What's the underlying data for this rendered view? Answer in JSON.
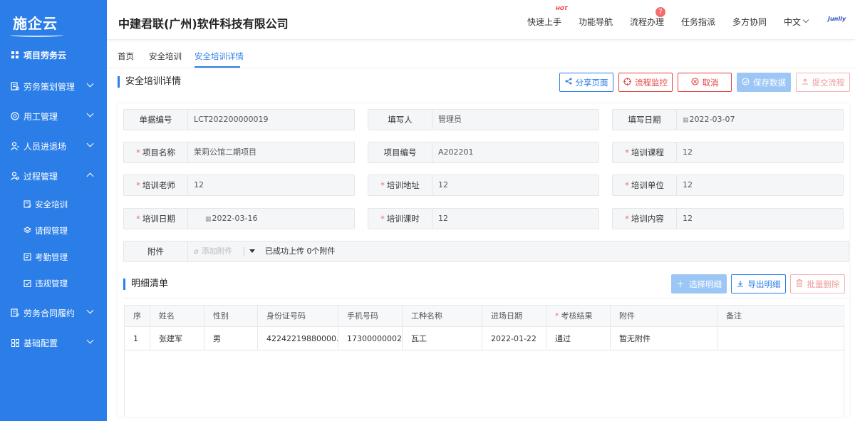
{
  "app": {
    "logo": "施企云"
  },
  "sidebar": {
    "home": "项目劳务云",
    "items": [
      {
        "label": "劳务策划管理",
        "icon": "plan-icon"
      },
      {
        "label": "用工管理",
        "icon": "employ-icon"
      },
      {
        "label": "人员进退场",
        "icon": "person-icon"
      },
      {
        "label": "过程管理",
        "icon": "process-icon"
      }
    ],
    "sub_items": [
      {
        "label": "安全培训",
        "icon": "training-icon"
      },
      {
        "label": "请假管理",
        "icon": "leave-icon"
      },
      {
        "label": "考勤管理",
        "icon": "attendance-icon"
      },
      {
        "label": "违规管理",
        "icon": "violation-icon"
      }
    ],
    "items_after": [
      {
        "label": "劳务合同履约",
        "icon": "contract-icon"
      },
      {
        "label": "基础配置",
        "icon": "config-icon"
      }
    ]
  },
  "header": {
    "company": "中建君联(广州)软件科技有限公司",
    "nav": [
      "快速上手",
      "功能导航",
      "流程办理",
      "任务指派",
      "多方协同",
      "中文"
    ],
    "hot_label": "HOT",
    "process_badge": "7",
    "brand": "Junlly"
  },
  "tabs": [
    "首页",
    "安全培训",
    "安全培训详情"
  ],
  "page": {
    "title": "安全培训详情",
    "actions": {
      "share": "分享页面",
      "monitor": "流程监控",
      "cancel": "取消",
      "save": "保存数据",
      "submit": "提交流程"
    }
  },
  "form": {
    "doc_no": {
      "label": "单据编号",
      "value": "LCT202200000019"
    },
    "writer": {
      "label": "填写人",
      "value": "管理员"
    },
    "write_date": {
      "label": "填写日期",
      "value": "2022-03-07"
    },
    "project_name": {
      "label": "项目名称",
      "value": "茉莉公馆二期项目"
    },
    "project_no": {
      "label": "项目编号",
      "value": "A202201"
    },
    "course": {
      "label": "培训课程",
      "value": "12"
    },
    "teacher": {
      "label": "培训老师",
      "value": "12"
    },
    "address": {
      "label": "培训地址",
      "value": "12"
    },
    "unit": {
      "label": "培训单位",
      "value": "12"
    },
    "train_date": {
      "label": "培训日期",
      "value": "2022-03-16"
    },
    "hours": {
      "label": "培训课时",
      "value": "12"
    },
    "content": {
      "label": "培训内容",
      "value": "12"
    },
    "attachment": {
      "label": "附件",
      "add": "添加附件",
      "status": "已成功上传 0个附件"
    }
  },
  "detail": {
    "title": "明细清单",
    "actions": {
      "select": "选择明细",
      "export": "导出明细",
      "delete": "批量删除"
    },
    "columns": [
      "序",
      "姓名",
      "性别",
      "身份证号码",
      "手机号码",
      "工种名称",
      "进场日期",
      "考核结果",
      "附件",
      "备注"
    ],
    "rows": [
      [
        "1",
        "张建军",
        "男",
        "42242219880000...",
        "17300000002",
        "瓦工",
        "2022-01-22",
        "通过",
        "暂无附件",
        ""
      ]
    ]
  }
}
